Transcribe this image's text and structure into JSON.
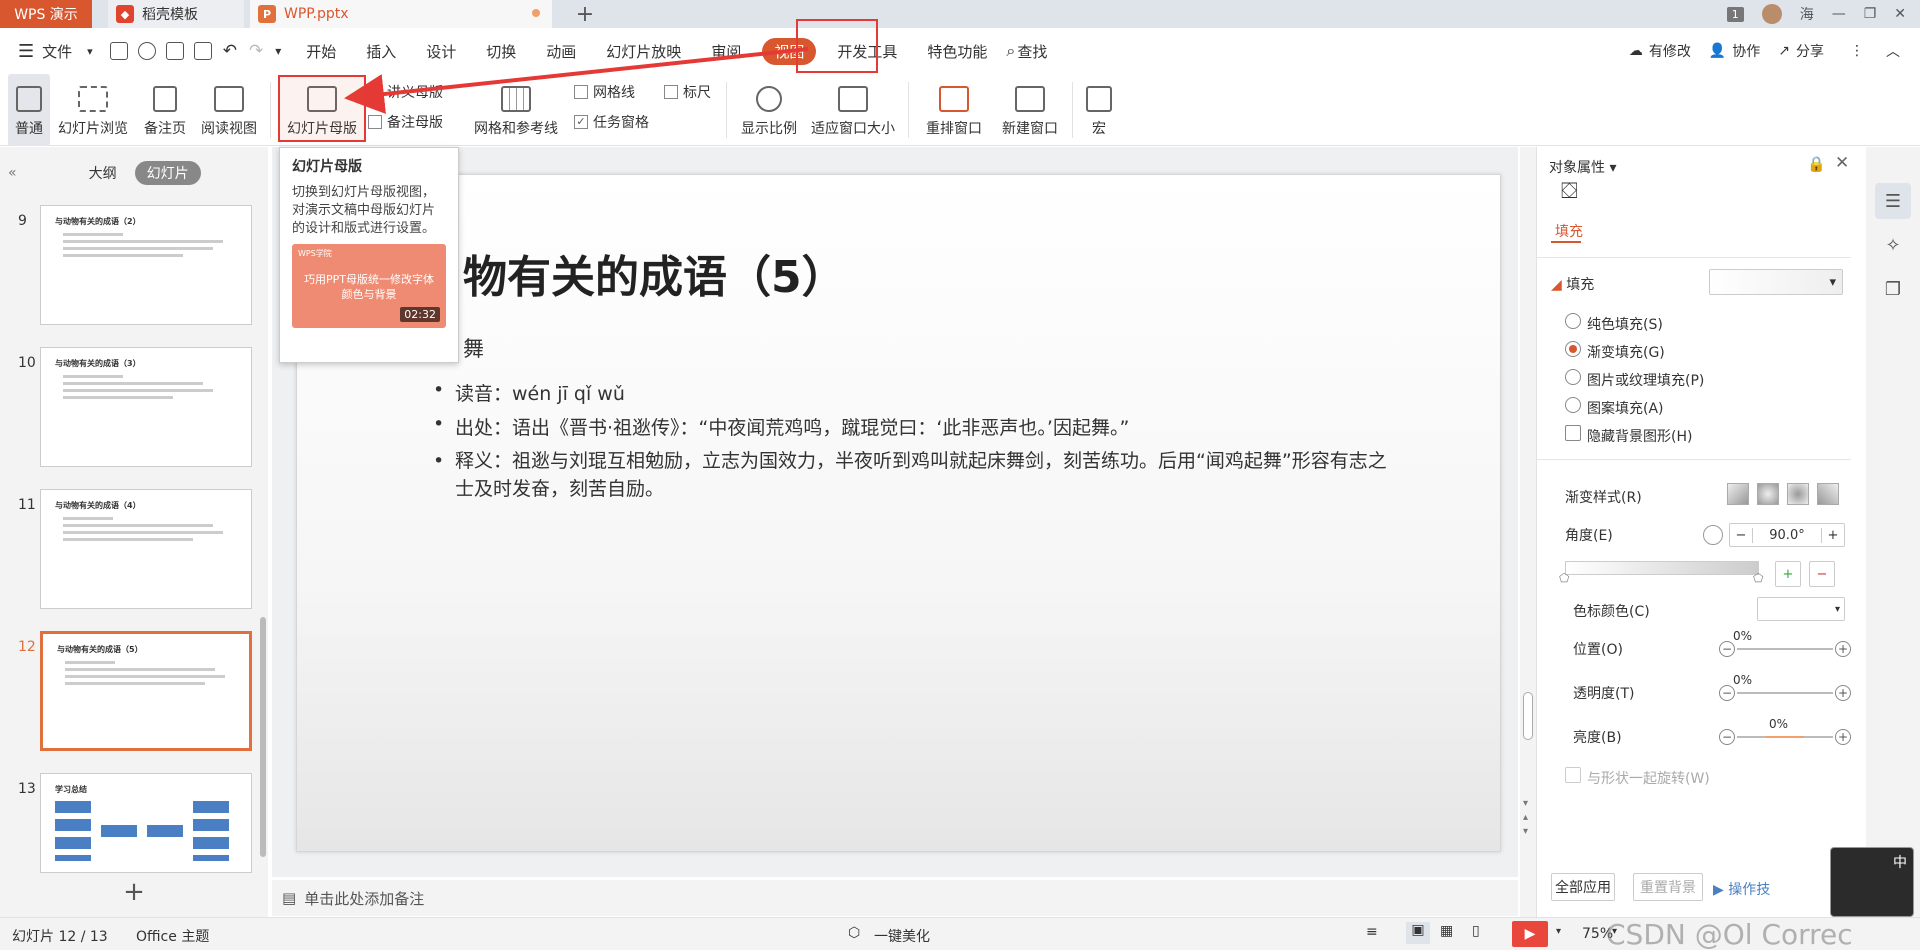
{
  "tabs": {
    "wps": "WPS 演示",
    "template": "稻壳模板",
    "file": "WPP.pptx",
    "badge": "1",
    "user": "海"
  },
  "menu": {
    "file": "文件",
    "items": [
      "开始",
      "插入",
      "设计",
      "切换",
      "动画",
      "幻灯片放映",
      "审阅",
      "视图",
      "开发工具",
      "特色功能"
    ],
    "active": "视图",
    "search": "查找",
    "changes": "有修改",
    "collab": "协作",
    "share": "分享"
  },
  "ribbon": {
    "normal": "普通",
    "slide_sorter": "幻灯片浏览",
    "notes_page": "备注页",
    "reading": "阅读视图",
    "slide_master": "幻灯片母版",
    "handout_master": "讲义母版",
    "notes_master": "备注母版",
    "grid_guides": "网格和参考线",
    "gridlines": "网格线",
    "ruler": "标尺",
    "task_pane": "任务窗格",
    "zoom": "显示比例",
    "fit_window": "适应窗口大小",
    "arrange": "重排窗口",
    "new_window": "新建窗口",
    "macro": "宏"
  },
  "tooltip": {
    "title": "幻灯片母版",
    "body": "切换到幻灯片母版视图，对演示文稿中母版幻灯片的设计和版式进行设置。",
    "card_brand": "WPS学院",
    "card_text": "巧用PPT母版统一修改字体颜色与背景",
    "duration": "02:32"
  },
  "left_panel": {
    "outline": "大纲",
    "slides": "幻灯片",
    "thumbs": [
      {
        "num": "9",
        "title": "与动物有关的成语（2）"
      },
      {
        "num": "10",
        "title": "与动物有关的成语（3）"
      },
      {
        "num": "11",
        "title": "与动物有关的成语（4）"
      },
      {
        "num": "12",
        "title": "与动物有关的成语（5）"
      },
      {
        "num": "13",
        "title": "学习总结"
      }
    ]
  },
  "slide": {
    "title": "物有关的成语（5）",
    "subtitle": "舞",
    "bullets": [
      "读音：wén jī qǐ wǔ",
      "出处：语出《晋书·祖逖传》：“中夜闻荒鸡鸣，蹴琨觉曰：‘此非恶声也。’因起舞。”",
      "释义：祖逖与刘琨互相勉励，立志为国效力，半夜听到鸡叫就起床舞剑，刻苦练功。后用“闻鸡起舞”形容有志之士及时发奋，刻苦自励。"
    ]
  },
  "notes": "单击此处添加备注",
  "right_panel": {
    "title": "对象属性",
    "tab": "填充",
    "section": "填充",
    "options": [
      "纯色填充(S)",
      "渐变填充(G)",
      "图片或纹理填充(P)",
      "图案填充(A)",
      "隐藏背景图形(H)"
    ],
    "gradient_style": "渐变样式(R)",
    "angle_label": "角度(E)",
    "angle_value": "90.0°",
    "stop_color": "色标颜色(C)",
    "position": "位置(O)",
    "position_value": "0%",
    "transparency": "透明度(T)",
    "transparency_value": "0%",
    "brightness": "亮度(B)",
    "brightness_value": "0%",
    "rotate_with_shape": "与形状一起旋转(W)",
    "apply_all": "全部应用",
    "reset_bg": "重置背景",
    "tips": "操作技"
  },
  "status": {
    "slide_info": "幻灯片 12 / 13",
    "theme": "Office 主题",
    "beautify": "一键美化",
    "zoom": "75%",
    "watermark": "CSDN @Ol Correc"
  },
  "colors": {
    "accent": "#d9572f",
    "arrow": "#e53935"
  }
}
